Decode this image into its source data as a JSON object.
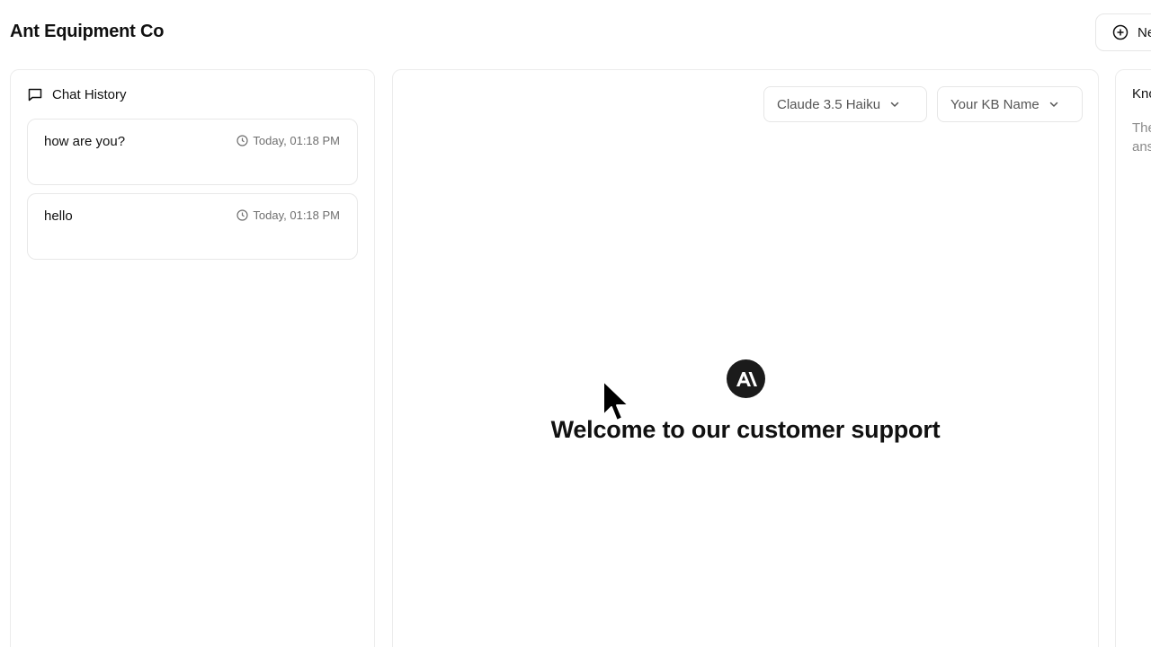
{
  "app": {
    "title": "Ant Equipment Co"
  },
  "header": {
    "new_chat_label": "New Chat"
  },
  "history": {
    "title": "Chat History",
    "items": [
      {
        "title": "how are you?",
        "time": "Today, 01:18 PM"
      },
      {
        "title": "hello",
        "time": "Today, 01:18 PM"
      }
    ]
  },
  "chat": {
    "model_select": "Claude 3.5 Haiku",
    "kb_select": "Your KB Name",
    "welcome": "Welcome to our customer support"
  },
  "knowledge_panel": {
    "title": "Knowledge Base",
    "description": "The sources used to find the answer will appear here."
  },
  "colors": {
    "text": "#111111",
    "muted": "#6f6f6f",
    "border": "#e6e6e6",
    "logo_bg": "#1b1b1b"
  }
}
